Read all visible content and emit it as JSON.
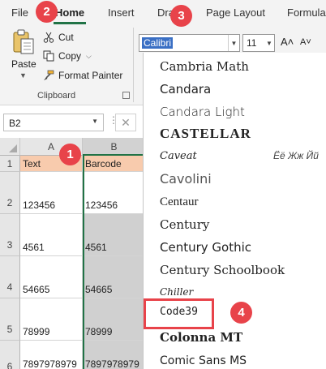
{
  "ribbon": {
    "tabs": [
      {
        "label": "File"
      },
      {
        "label": "Home"
      },
      {
        "label": "Insert"
      },
      {
        "label": "Draw"
      },
      {
        "label": "Page Layout"
      },
      {
        "label": "Formulas"
      }
    ],
    "clipboard": {
      "paste_label": "Paste",
      "cut_label": "Cut",
      "copy_label": "Copy",
      "format_painter_label": "Format Painter",
      "group_label": "Clipboard"
    },
    "font": {
      "font_name_value": "Calibri",
      "font_size_value": "11",
      "grow_label": "A˄",
      "shrink_label": "A˅"
    }
  },
  "formula_bar": {
    "name_box_value": "B2",
    "cancel_symbol": "✕"
  },
  "grid": {
    "columns": [
      "A",
      "B"
    ],
    "row_numbers": [
      "1",
      "2",
      "3",
      "4",
      "5",
      "6"
    ],
    "headers": {
      "a": "Text",
      "b": "Barcode"
    },
    "rows": [
      {
        "a": "123456",
        "b": "123456"
      },
      {
        "a": "4561",
        "b": "4561"
      },
      {
        "a": "54665",
        "b": "54665"
      },
      {
        "a": "78999",
        "b": "78999"
      },
      {
        "a": "7897978979",
        "b": "7897978979"
      }
    ]
  },
  "font_list": {
    "items": [
      "Cambria Math",
      "Candara",
      "Candara Light",
      "CASTELLAR",
      "Caveat",
      "Cavolini",
      "Centaur",
      "Century",
      "Century Gothic",
      "Century Schoolbook",
      "Chiller",
      "Code39",
      "Colonna MT",
      "Comic Sans MS"
    ],
    "caveat_sample": "Ёё Жж Йй",
    "highlighted_item": "Code39"
  },
  "callouts": [
    "1",
    "2",
    "3",
    "4"
  ],
  "colors": {
    "accent": "#217346",
    "callout": "#e8434a",
    "header_fill": "#f8cbad",
    "selection_fill": "#d0d0d0",
    "font_name_highlight": "#3a6fc4"
  }
}
